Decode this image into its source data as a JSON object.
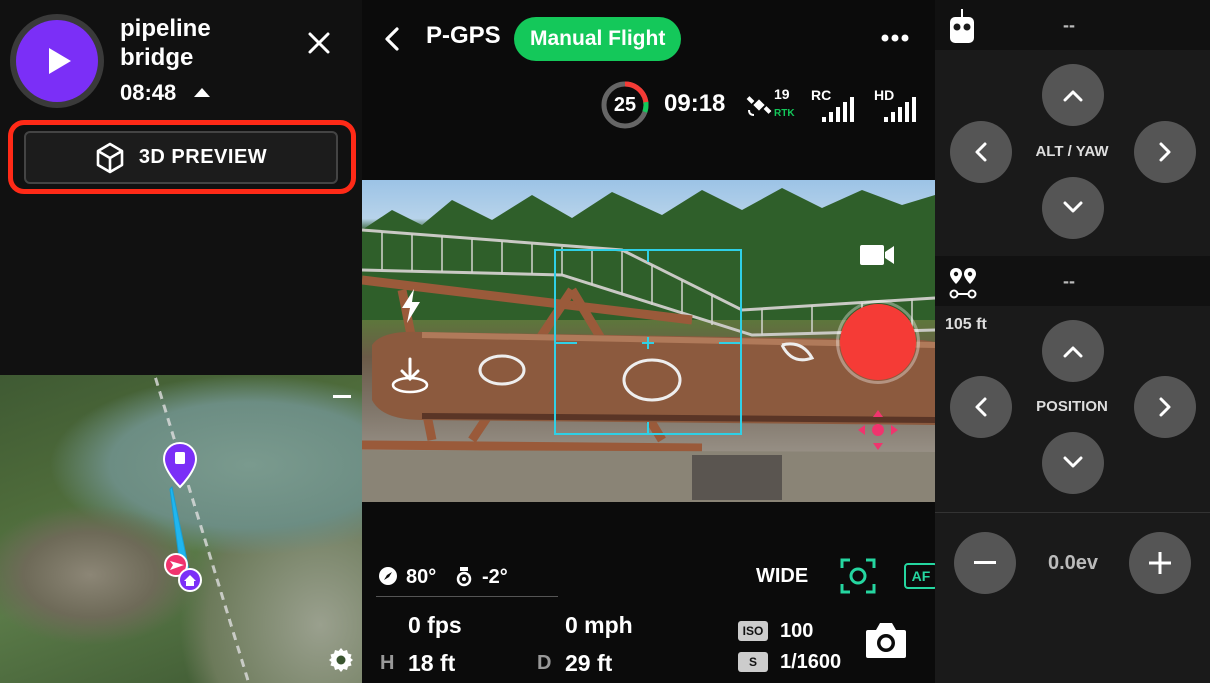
{
  "mission": {
    "name": "pipeline bridge",
    "duration": "08:48"
  },
  "preview_button": {
    "label": "3D PREVIEW"
  },
  "header": {
    "flight_mode": "P-GPS",
    "manual_flight_label": "Manual Flight"
  },
  "status": {
    "battery_percent": "25",
    "battery_fill_fraction": 0.25,
    "flight_time": "09:18",
    "satellites": "19",
    "rtk_label": "RTK",
    "rc_label": "RC",
    "hd_label": "HD"
  },
  "telemetry": {
    "heading": "80°",
    "gimbal_tilt": "-2°",
    "fps": "0 fps",
    "speed": "0 mph",
    "height_letter": "H",
    "height": "18 ft",
    "distance_letter": "D",
    "distance": "29 ft"
  },
  "camera": {
    "lens": "WIDE",
    "af_label": "AF",
    "iso_tag": "ISO",
    "iso_value": "100",
    "shutter_tag": "S",
    "shutter_value": "1/1600"
  },
  "right_panel": {
    "rc_status": "--",
    "altitude_yaw_label": "ALT / YAW",
    "waypoint_status": "--",
    "altitude_readout": "105 ft",
    "position_label": "POSITION",
    "exposure_value": "0.0ev"
  },
  "colors": {
    "accent_purple": "#7b2ff7",
    "manual_green": "#14c85a",
    "record_red": "#f53b36",
    "highlight_red": "#ff2a17",
    "focus_cyan": "#25d6a0"
  },
  "icons": {
    "play": "play-icon",
    "close": "close-icon",
    "cube": "cube-icon",
    "back": "chevron-left-icon",
    "more": "more-dots-icon",
    "satellite": "satellite-icon",
    "video": "video-camera-icon",
    "flash": "flash-icon",
    "record": "record-button",
    "move": "move-arrows-icon",
    "compass": "compass-icon",
    "gimbal": "gimbal-icon",
    "focus": "focus-frame-icon",
    "camera": "camera-icon",
    "remote": "remote-controller-icon",
    "waypoints": "waypoints-icon",
    "gear": "gear-icon"
  }
}
